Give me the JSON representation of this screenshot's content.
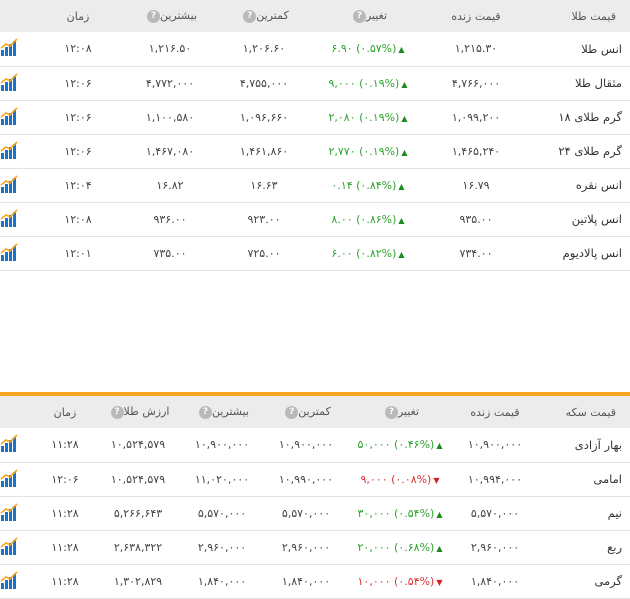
{
  "gold_table": {
    "headers": {
      "name": "قیمت طلا",
      "live": "قیمت زنده",
      "change": "تغییر",
      "low": "کمترین",
      "high": "بیشترین",
      "time": "زمان"
    },
    "help_icon": "?",
    "rows": [
      {
        "name": "انس طلا",
        "live": "۱,۲۱۵.۳۰",
        "change": "۶.۹۰ (۰.۵۷%)",
        "direction": "up",
        "low": "۱,۲۰۶.۶۰",
        "high": "۱,۲۱۶.۵۰",
        "time": "۱۲:۰۸"
      },
      {
        "name": "مثقال طلا",
        "live": "۴,۷۶۶,۰۰۰",
        "change": "۹,۰۰۰ (۰.۱۹%)",
        "direction": "up",
        "low": "۴,۷۵۵,۰۰۰",
        "high": "۴,۷۷۲,۰۰۰",
        "time": "۱۲:۰۶"
      },
      {
        "name": "گرم طلای ۱۸",
        "live": "۱,۰۹۹,۲۰۰",
        "change": "۲,۰۸۰ (۰.۱۹%)",
        "direction": "up",
        "low": "۱,۰۹۶,۶۶۰",
        "high": "۱,۱۰۰,۵۸۰",
        "time": "۱۲:۰۶"
      },
      {
        "name": "گرم طلای ۲۴",
        "live": "۱,۴۶۵,۲۴۰",
        "change": "۲,۷۷۰ (۰.۱۹%)",
        "direction": "up",
        "low": "۱,۴۶۱,۸۶۰",
        "high": "۱,۴۶۷,۰۸۰",
        "time": "۱۲:۰۶"
      },
      {
        "name": "انس نقره",
        "live": "۱۶.۷۹",
        "change": "۰.۱۴ (۰.۸۴%)",
        "direction": "up",
        "low": "۱۶.۶۳",
        "high": "۱۶.۸۲",
        "time": "۱۲:۰۴"
      },
      {
        "name": "انس پلاتین",
        "live": "۹۳۵.۰۰",
        "change": "۸.۰۰ (۰.۸۶%)",
        "direction": "up",
        "low": "۹۲۳.۰۰",
        "high": "۹۳۶.۰۰",
        "time": "۱۲:۰۸"
      },
      {
        "name": "انس پالادیوم",
        "live": "۷۳۴.۰۰",
        "change": "۶.۰۰ (۰.۸۲%)",
        "direction": "up",
        "low": "۷۲۵.۰۰",
        "high": "۷۳۵.۰۰",
        "time": "۱۲:۰۱"
      }
    ]
  },
  "coin_table": {
    "headers": {
      "name": "قیمت سکه",
      "live": "قیمت زنده",
      "change": "تغییر",
      "low": "کمترین",
      "high": "بیشترین",
      "gold_value": "ارزش طلا",
      "time": "زمان"
    },
    "rows": [
      {
        "name": "بهار آزادی",
        "live": "۱۰,۹۰۰,۰۰۰",
        "change": "۵۰,۰۰۰ (۰.۴۶%)",
        "direction": "up",
        "low": "۱۰,۹۰۰,۰۰۰",
        "high": "۱۰,۹۰۰,۰۰۰",
        "gold_value": "۱۰,۵۲۴,۵۷۹",
        "time": "۱۱:۲۸"
      },
      {
        "name": "امامی",
        "live": "۱۰,۹۹۴,۰۰۰",
        "change": "۹,۰۰۰ (۰.۰۸%)",
        "direction": "down",
        "low": "۱۰,۹۹۰,۰۰۰",
        "high": "۱۱,۰۲۰,۰۰۰",
        "gold_value": "۱۰,۵۲۴,۵۷۹",
        "time": "۱۲:۰۶"
      },
      {
        "name": "نیم",
        "live": "۵,۵۷۰,۰۰۰",
        "change": "۳۰,۰۰۰ (۰.۵۴%)",
        "direction": "up",
        "low": "۵,۵۷۰,۰۰۰",
        "high": "۵,۵۷۰,۰۰۰",
        "gold_value": "۵,۲۶۶,۶۴۳",
        "time": "۱۱:۲۸"
      },
      {
        "name": "ربع",
        "live": "۲,۹۶۰,۰۰۰",
        "change": "۲۰,۰۰۰ (۰.۶۸%)",
        "direction": "up",
        "low": "۲,۹۶۰,۰۰۰",
        "high": "۲,۹۶۰,۰۰۰",
        "gold_value": "۲,۶۳۸,۳۲۲",
        "time": "۱۱:۲۸"
      },
      {
        "name": "گرمی",
        "live": "۱,۸۴۰,۰۰۰",
        "change": "۱۰,۰۰۰ (۰.۵۴%)",
        "direction": "down",
        "low": "۱,۸۴۰,۰۰۰",
        "high": "۱,۸۴۰,۰۰۰",
        "gold_value": "۱,۳۰۲,۸۲۹",
        "time": "۱۱:۲۸"
      }
    ]
  },
  "colors": {
    "up": "#2ea32e",
    "down": "#d83232",
    "divider": "#f5a623",
    "chart_icon": "#1a73c8"
  },
  "icons": {
    "chart": "bar-chart-icon",
    "help": "help-icon",
    "arrow_up": "arrow-up-icon",
    "arrow_down": "arrow-down-icon"
  }
}
